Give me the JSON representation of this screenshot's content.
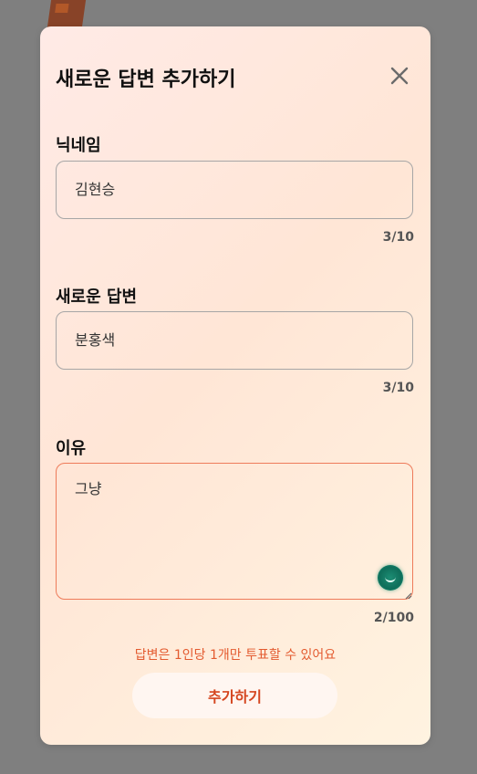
{
  "modal": {
    "title": "새로운 답변 추가하기"
  },
  "fields": {
    "nickname": {
      "label": "닉네임",
      "value": "김현승",
      "counter": "3/10"
    },
    "answer": {
      "label": "새로운 답변",
      "value": "분홍색",
      "counter": "3/10"
    },
    "reason": {
      "label": "이유",
      "value": "그냥",
      "counter": "2/100"
    }
  },
  "notice": "답변은 1인당 1개만 투표할 수 있어요",
  "submit_label": "추가하기",
  "colors": {
    "accent": "#e35a2f",
    "overlay": "#7f7f7f",
    "textarea_border": "#ee7b5a"
  },
  "icons": {
    "close": "close-icon",
    "grammar": "grammar-assistant-icon",
    "resize": "resize-handle-icon"
  }
}
